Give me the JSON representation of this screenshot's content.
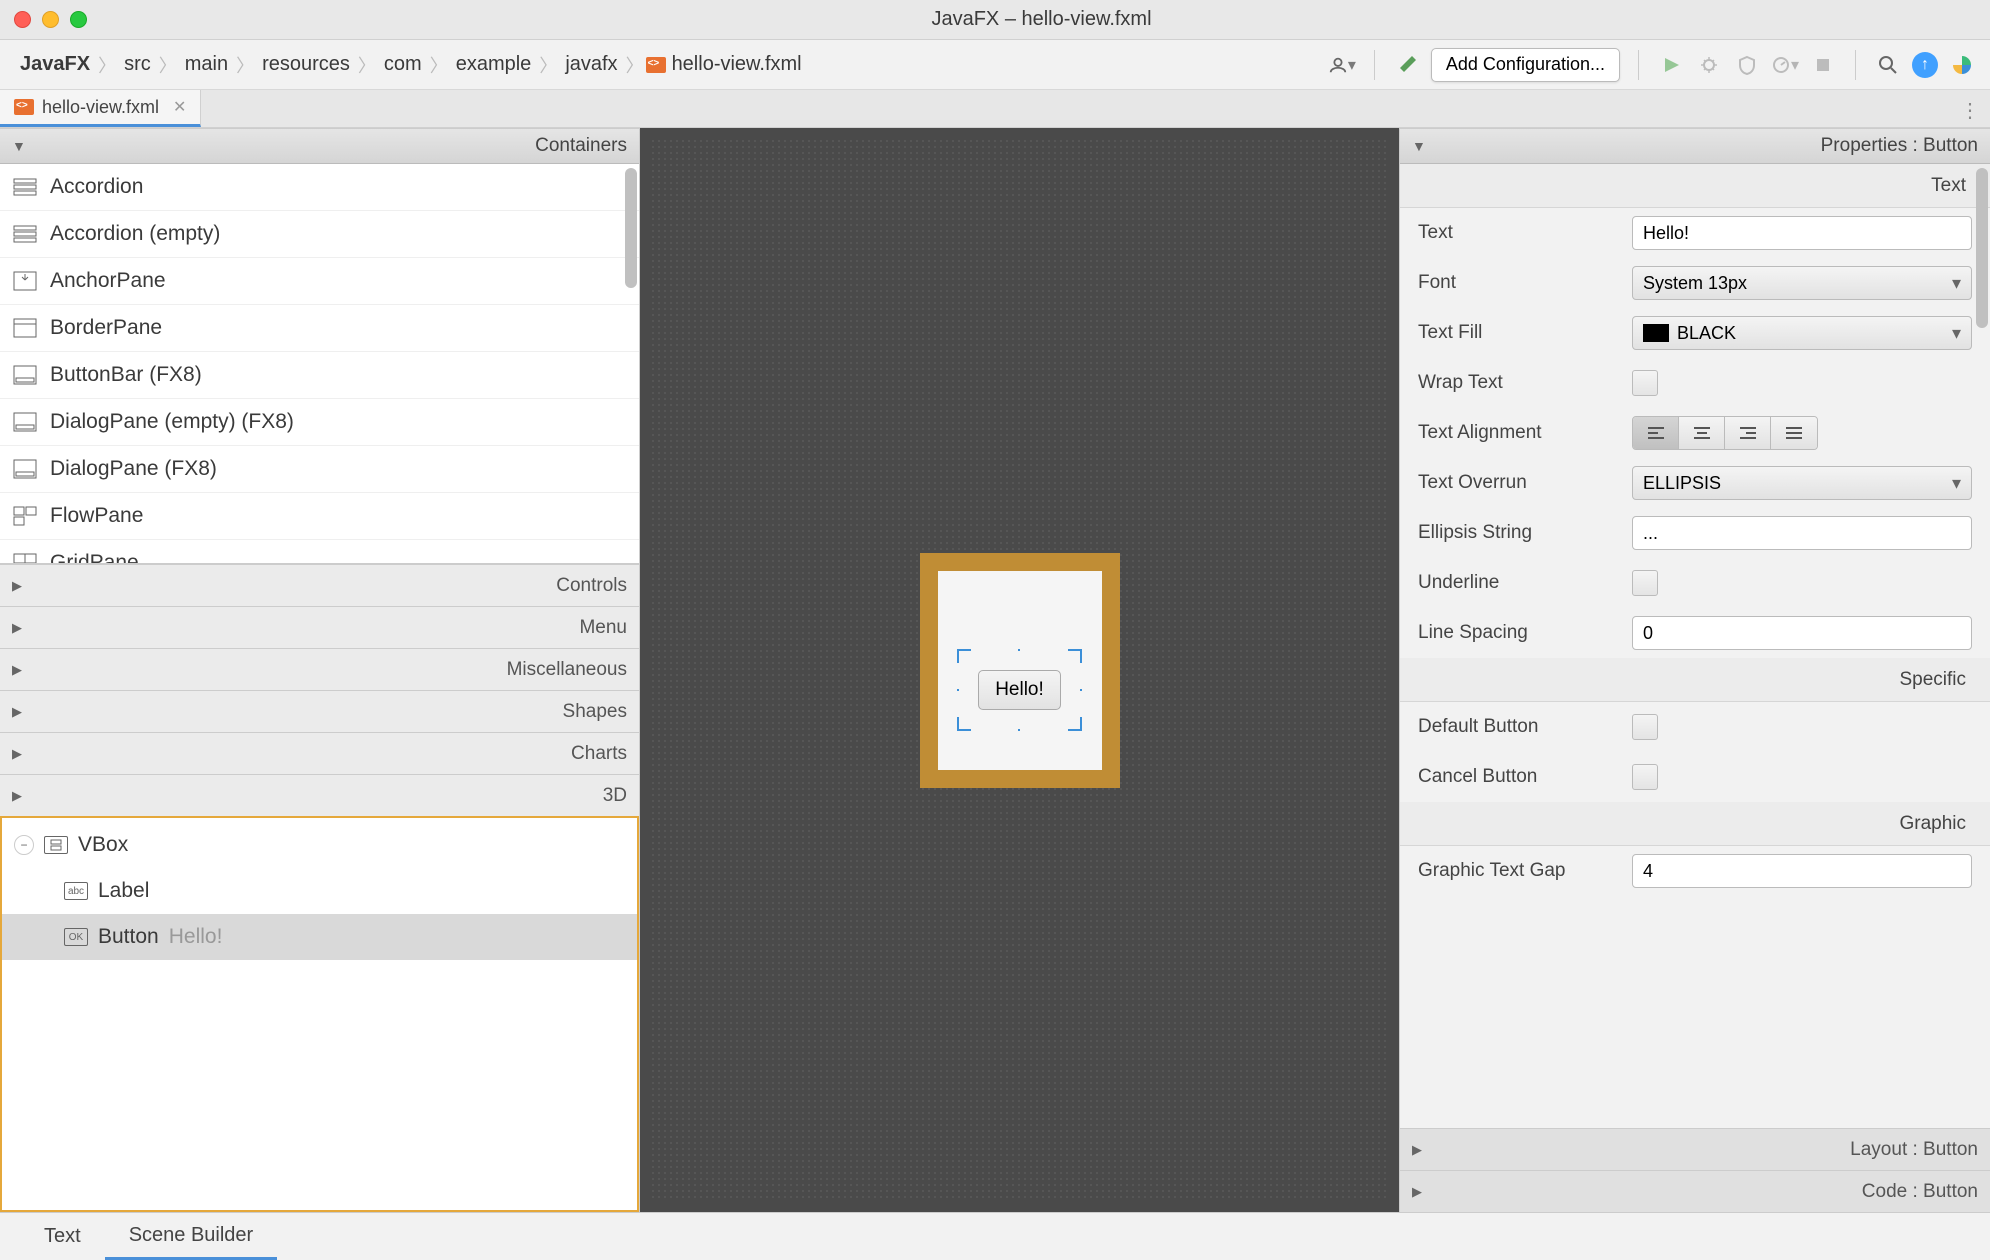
{
  "window": {
    "title": "JavaFX – hello-view.fxml"
  },
  "breadcrumb": {
    "project": "JavaFX",
    "items": [
      "src",
      "main",
      "resources",
      "com",
      "example",
      "javafx",
      "hello-view.fxml"
    ]
  },
  "toolbar": {
    "add_config": "Add Configuration..."
  },
  "tabs": {
    "open_file": "hello-view.fxml"
  },
  "library": {
    "containers_header": "Containers",
    "items": [
      "Accordion",
      "Accordion  (empty)",
      "AnchorPane",
      "BorderPane",
      "ButtonBar  (FX8)",
      "DialogPane (empty)  (FX8)",
      "DialogPane  (FX8)",
      "FlowPane",
      "GridPane"
    ],
    "sections": [
      "Controls",
      "Menu",
      "Miscellaneous",
      "Shapes",
      "Charts",
      "3D"
    ]
  },
  "hierarchy": {
    "root": "VBox",
    "child1": "Label",
    "child2": "Button",
    "child2_text": "Hello!"
  },
  "canvas": {
    "button_text": "Hello!"
  },
  "properties": {
    "header": "Properties : Button",
    "group_text": "Text",
    "text_label": "Text",
    "text_value": "Hello!",
    "font_label": "Font",
    "font_value": "System 13px",
    "textfill_label": "Text Fill",
    "textfill_value": "BLACK",
    "wrap_label": "Wrap Text",
    "align_label": "Text Alignment",
    "overrun_label": "Text Overrun",
    "overrun_value": "ELLIPSIS",
    "ellipsis_label": "Ellipsis String",
    "ellipsis_value": "...",
    "underline_label": "Underline",
    "linespacing_label": "Line Spacing",
    "linespacing_value": "0",
    "group_specific": "Specific",
    "default_btn_label": "Default Button",
    "cancel_btn_label": "Cancel Button",
    "group_graphic": "Graphic",
    "graphic_gap_label": "Graphic Text Gap",
    "graphic_gap_value": "4",
    "layout_header": "Layout : Button",
    "code_header": "Code : Button"
  },
  "bottom_tabs": {
    "text": "Text",
    "scene_builder": "Scene Builder"
  }
}
